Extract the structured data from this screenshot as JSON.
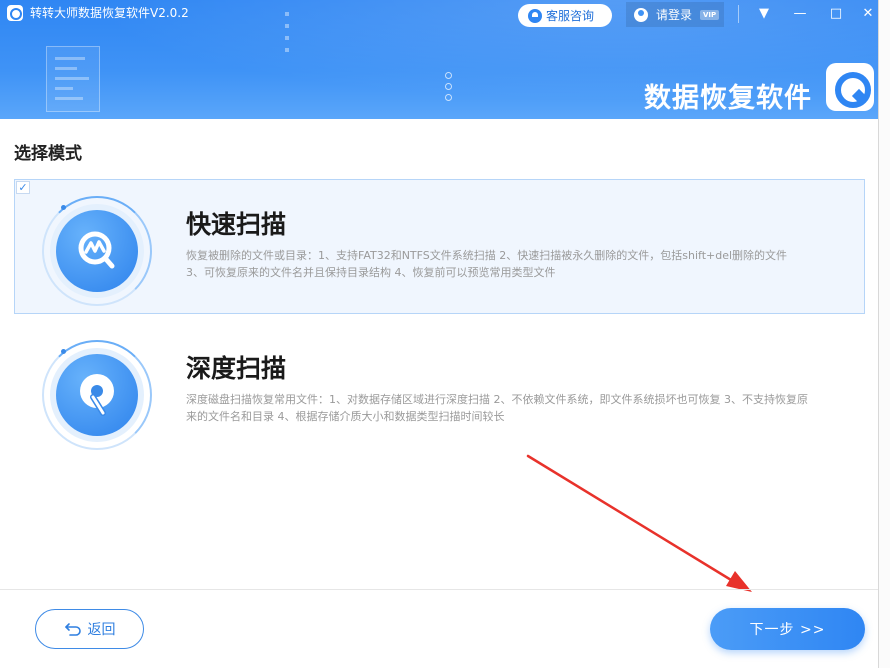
{
  "window": {
    "title": "转转大师数据恢复软件V2.0.2",
    "brand": "数据恢复软件",
    "controls": [
      "▼",
      "—",
      "□",
      "✕"
    ]
  },
  "header": {
    "service_label": "客服咨询",
    "login_label": "请登录",
    "vip_badge": "VIP"
  },
  "page": {
    "section_title": "选择模式"
  },
  "modes": [
    {
      "title": "快速扫描",
      "description": "恢复被删除的文件或目录：1、支持FAT32和NTFS文件系统扫描 2、快速扫描被永久删除的文件，包括shift+del删除的文件 3、可恢复原来的文件名并且保持目录结构 4、恢复前可以预览常用类型文件",
      "checkmark": "✓",
      "selected": true
    },
    {
      "title": "深度扫描",
      "description": "深度磁盘扫描恢复常用文件：1、对数据存储区域进行深度扫描 2、不依赖文件系统，即文件系统损坏也可恢复 3、不支持恢复原来的文件名和目录 4、根据存储介质大小和数据类型扫描时间较长",
      "selected": false
    }
  ],
  "footer": {
    "back_label": "返回",
    "next_label": "下一步 >>"
  },
  "colors": {
    "accent": "#2f86f3",
    "annotation_arrow": "#e8322b"
  },
  "icons": {
    "quick_scan": "magnifier-wave-icon",
    "deep_scan": "disk-scan-icon",
    "back": "return-arrow-icon"
  }
}
